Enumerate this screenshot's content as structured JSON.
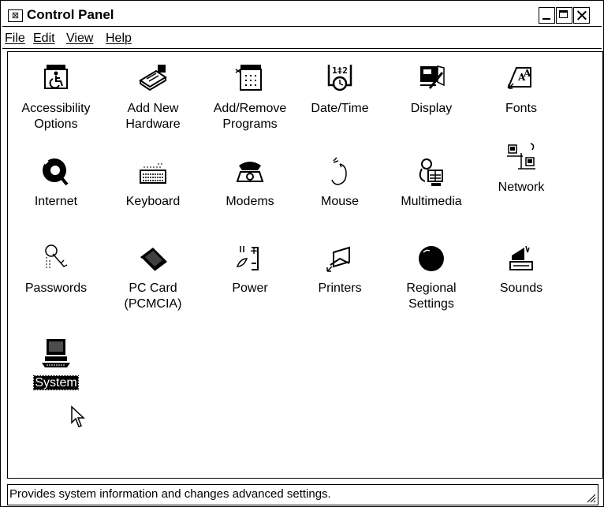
{
  "window": {
    "title": "Control Panel",
    "system_menu_glyph": "⊠"
  },
  "menubar": {
    "items": [
      {
        "label": "File"
      },
      {
        "label": "Edit"
      },
      {
        "label": "View"
      },
      {
        "label": "Help"
      }
    ]
  },
  "icons": [
    {
      "label": "Accessibility\nOptions",
      "icon": "accessibility-icon"
    },
    {
      "label": "Add New\nHardware",
      "icon": "add-new-hardware-icon"
    },
    {
      "label": "Add/Remove\nPrograms",
      "icon": "add-remove-programs-icon"
    },
    {
      "label": "Date/Time",
      "icon": "date-time-icon"
    },
    {
      "label": "Display",
      "icon": "display-icon"
    },
    {
      "label": "Fonts",
      "icon": "fonts-icon"
    },
    {
      "label": "Internet",
      "icon": "internet-icon"
    },
    {
      "label": "Keyboard",
      "icon": "keyboard-icon"
    },
    {
      "label": "Modems",
      "icon": "modems-icon"
    },
    {
      "label": "Mouse",
      "icon": "mouse-icon"
    },
    {
      "label": "Multimedia",
      "icon": "multimedia-icon"
    },
    {
      "label": "Network",
      "icon": "network-icon"
    },
    {
      "label": "Passwords",
      "icon": "passwords-icon"
    },
    {
      "label": "PC Card\n(PCMCIA)",
      "icon": "pc-card-icon"
    },
    {
      "label": "Power",
      "icon": "power-icon"
    },
    {
      "label": "Printers",
      "icon": "printers-icon"
    },
    {
      "label": "Regional\nSettings",
      "icon": "regional-settings-icon"
    },
    {
      "label": "Sounds",
      "icon": "sounds-icon"
    },
    {
      "label": "System",
      "icon": "system-icon",
      "selected": true
    }
  ],
  "statusbar": {
    "text": "Provides system information and changes advanced settings."
  }
}
